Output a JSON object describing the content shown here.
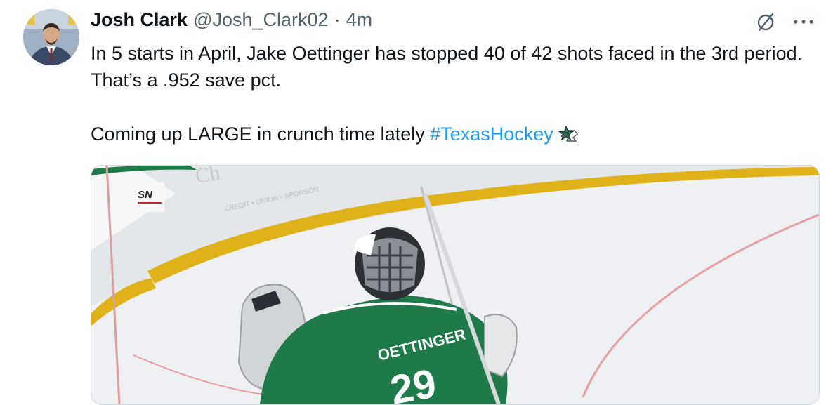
{
  "tweet": {
    "author": {
      "display_name": "Josh Clark",
      "handle": "@Josh_Clark02"
    },
    "separator": "·",
    "timestamp": "4m",
    "text": {
      "line1": "In 5 starts in April, Jake Oettinger has stopped 40 of 42 shots faced in the 3rd period. That’s a .952 save pct.",
      "line2": "Coming up LARGE in crunch time lately ",
      "hashtag": "#TexasHockey"
    },
    "icons": {
      "grok": "grok-icon",
      "more": "more-icon",
      "emoji": "dallas-stars-emoji-icon"
    },
    "media": {
      "network_logo": "SN",
      "jersey_name": "OETTINGER",
      "jersey_number": "29",
      "kind": "video thumbnail"
    },
    "colors": {
      "hashtag": "#1d9bf0",
      "secondary_text": "#536471",
      "stars_green": "#1f6b3d"
    }
  }
}
